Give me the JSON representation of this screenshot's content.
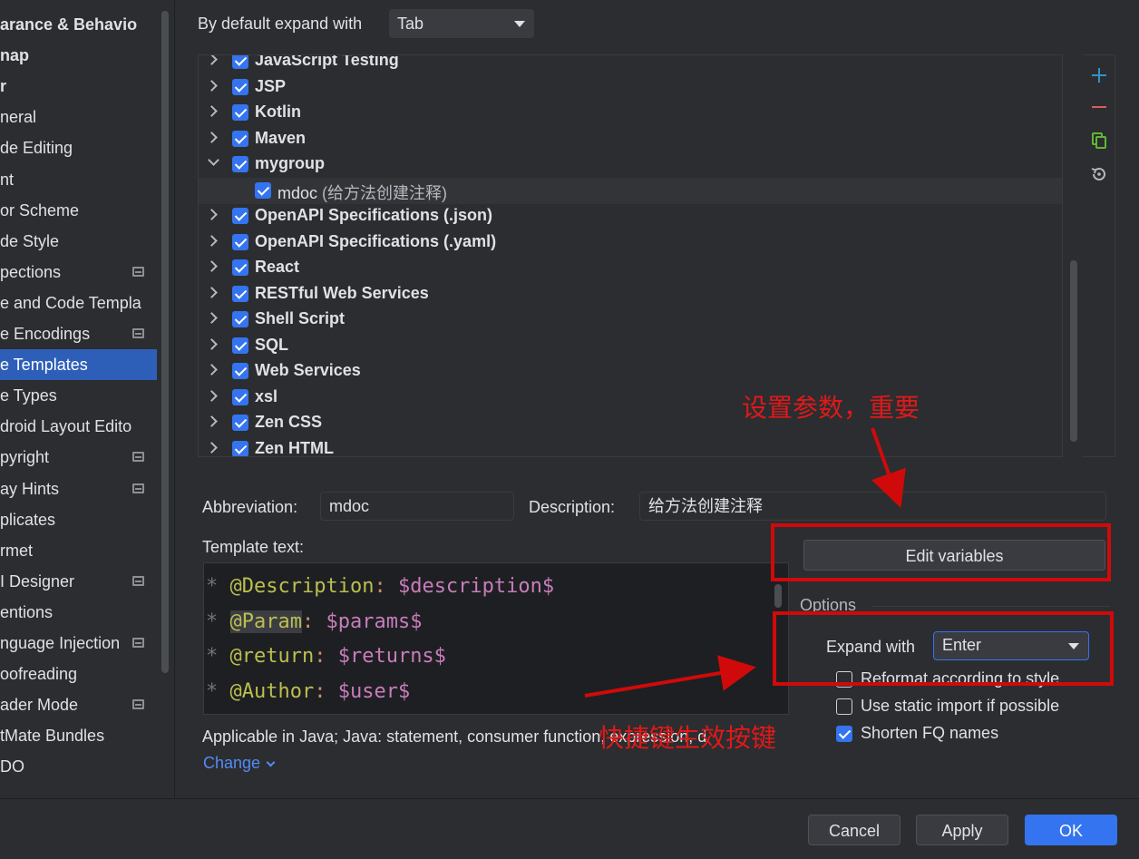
{
  "sidebar": {
    "items": [
      {
        "label": "arance & Behavio",
        "bold": true,
        "icon": false,
        "selected": false
      },
      {
        "label": "nap",
        "bold": true,
        "icon": false,
        "selected": false
      },
      {
        "label": "r",
        "bold": true,
        "icon": false,
        "selected": false
      },
      {
        "label": "neral",
        "bold": false,
        "icon": false,
        "selected": false
      },
      {
        "label": "de Editing",
        "bold": false,
        "icon": false,
        "selected": false
      },
      {
        "label": "nt",
        "bold": false,
        "icon": false,
        "selected": false
      },
      {
        "label": "or Scheme",
        "bold": false,
        "icon": false,
        "selected": false
      },
      {
        "label": "de Style",
        "bold": false,
        "icon": false,
        "selected": false
      },
      {
        "label": "pections",
        "bold": false,
        "icon": true,
        "selected": false
      },
      {
        "label": "e and Code Templa",
        "bold": false,
        "icon": false,
        "selected": false
      },
      {
        "label": "e Encodings",
        "bold": false,
        "icon": true,
        "selected": false
      },
      {
        "label": "e Templates",
        "bold": false,
        "icon": false,
        "selected": true
      },
      {
        "label": "e Types",
        "bold": false,
        "icon": false,
        "selected": false
      },
      {
        "label": "droid Layout Edito",
        "bold": false,
        "icon": false,
        "selected": false
      },
      {
        "label": "pyright",
        "bold": false,
        "icon": true,
        "selected": false
      },
      {
        "label": "ay Hints",
        "bold": false,
        "icon": true,
        "selected": false
      },
      {
        "label": "plicates",
        "bold": false,
        "icon": false,
        "selected": false
      },
      {
        "label": "rmet",
        "bold": false,
        "icon": false,
        "selected": false
      },
      {
        "label": "I Designer",
        "bold": false,
        "icon": true,
        "selected": false
      },
      {
        "label": "entions",
        "bold": false,
        "icon": false,
        "selected": false
      },
      {
        "label": "nguage Injection",
        "bold": false,
        "icon": true,
        "selected": false
      },
      {
        "label": "oofreading",
        "bold": false,
        "icon": false,
        "selected": false
      },
      {
        "label": "ader Mode",
        "bold": false,
        "icon": true,
        "selected": false
      },
      {
        "label": "tMate Bundles",
        "bold": false,
        "icon": false,
        "selected": false
      },
      {
        "label": "DO",
        "bold": false,
        "icon": false,
        "selected": false
      }
    ]
  },
  "header": {
    "expand_label": "By default expand with",
    "expand_value": "Tab"
  },
  "tree": {
    "groups": [
      {
        "name": "JavaScript Testing",
        "expanded": false
      },
      {
        "name": "JSP",
        "expanded": false
      },
      {
        "name": "Kotlin",
        "expanded": false
      },
      {
        "name": "Maven",
        "expanded": false
      },
      {
        "name": "mygroup",
        "expanded": true
      },
      {
        "name": "mdoc",
        "desc": "(给方法创建注释)",
        "child": true
      },
      {
        "name": "OpenAPI Specifications (.json)",
        "expanded": false
      },
      {
        "name": "OpenAPI Specifications (.yaml)",
        "expanded": false
      },
      {
        "name": "React",
        "expanded": false
      },
      {
        "name": "RESTful Web Services",
        "expanded": false
      },
      {
        "name": "Shell Script",
        "expanded": false
      },
      {
        "name": "SQL",
        "expanded": false
      },
      {
        "name": "Web Services",
        "expanded": false
      },
      {
        "name": "xsl",
        "expanded": false
      },
      {
        "name": "Zen CSS",
        "expanded": false
      },
      {
        "name": "Zen HTML",
        "expanded": false
      }
    ]
  },
  "form": {
    "abbreviation_label": "Abbreviation:",
    "abbreviation_value": "mdoc",
    "description_label": "Description:",
    "description_value": "给方法创建注释",
    "template_text_label": "Template text:",
    "edit_variables": "Edit variables",
    "options_label": "Options",
    "expand_with_label": "Expand with",
    "expand_with_value": "Enter",
    "reformat": "Reformat according to style",
    "static_import": "Use static import if possible",
    "shorten_fq": "Shorten FQ names",
    "applicable": "Applicable in Java; Java: statement, consumer function, expression, d",
    "change": "Change"
  },
  "code": {
    "lines": [
      {
        "star": "*",
        "tag": "@Description",
        "punct": ":",
        "var": "$description$",
        "hl": false
      },
      {
        "star": "*",
        "tag": "@Param",
        "punct": ":",
        "var": "$params$",
        "hl": true
      },
      {
        "star": "*",
        "tag": "@return",
        "punct": ":",
        "var": "$returns$",
        "hl": false
      },
      {
        "star": "*",
        "tag": "@Author",
        "punct": ":",
        "var": "$user$",
        "hl": false
      }
    ]
  },
  "footer": {
    "cancel": "Cancel",
    "apply": "Apply",
    "ok": "OK"
  },
  "annotations": {
    "params_note": "设置参数，重要",
    "shortcut_note": "快捷键生效按键"
  },
  "colors": {
    "accent": "#3574f0",
    "annotation_red": "#d00a0a",
    "background": "#2b2d30"
  }
}
